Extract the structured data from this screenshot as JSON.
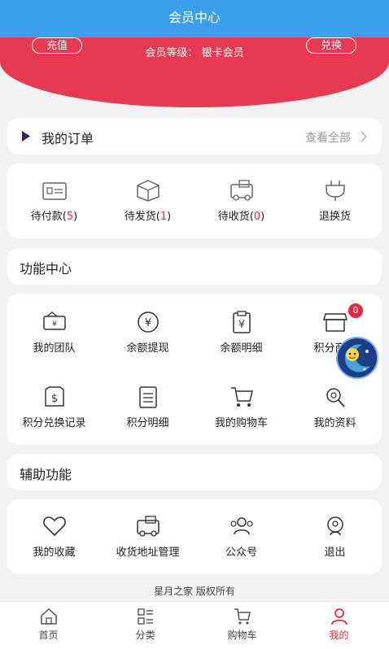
{
  "header": {
    "title": "会员中心"
  },
  "banner": {
    "recharge_label": "充值",
    "exchange_label": "兑换",
    "member_level_label": "会员等级：",
    "member_level_value": "银卡会员"
  },
  "orders": {
    "title": "我的订单",
    "view_all": "查看全部",
    "items": [
      {
        "name": "待付款",
        "count": "5",
        "icon": "wallet-icon"
      },
      {
        "name": "待发货",
        "count": "1",
        "icon": "box-icon"
      },
      {
        "name": "待收货",
        "count": "0",
        "icon": "truck-icon"
      },
      {
        "name": "退换货",
        "icon": "return-icon"
      }
    ]
  },
  "functions": {
    "title": "功能中心",
    "items": [
      {
        "name": "我的团队",
        "icon": "ticket-icon"
      },
      {
        "name": "余额提现",
        "icon": "yen-refresh-icon"
      },
      {
        "name": "余额明细",
        "icon": "yen-clipboard-icon"
      },
      {
        "name": "积分商城",
        "icon": "shop-icon",
        "badge": "0"
      },
      {
        "name": "积分兑换记录",
        "icon": "dollar-bag-icon"
      },
      {
        "name": "积分明细",
        "icon": "list-icon"
      },
      {
        "name": "我的购物车",
        "icon": "cart-icon"
      },
      {
        "name": "我的资料",
        "icon": "profile-icon"
      }
    ]
  },
  "aux": {
    "title": "辅助功能",
    "items": [
      {
        "name": "我的收藏",
        "icon": "heart-icon"
      },
      {
        "name": "收货地址管理",
        "icon": "truck-icon"
      },
      {
        "name": "公众号",
        "icon": "people-icon"
      },
      {
        "name": "退出",
        "icon": "exit-icon"
      }
    ]
  },
  "footer": {
    "copyright": "星月之家   版权所有"
  },
  "tabbar": {
    "items": [
      {
        "label": "首页",
        "icon": "home-icon"
      },
      {
        "label": "分类",
        "icon": "category-icon"
      },
      {
        "label": "购物车",
        "icon": "cart-icon"
      },
      {
        "label": "我的",
        "icon": "user-icon",
        "active": true
      }
    ]
  },
  "colors": {
    "header": "#3aa0ee",
    "banner": "#e63a53",
    "accent": "#e6283c"
  }
}
